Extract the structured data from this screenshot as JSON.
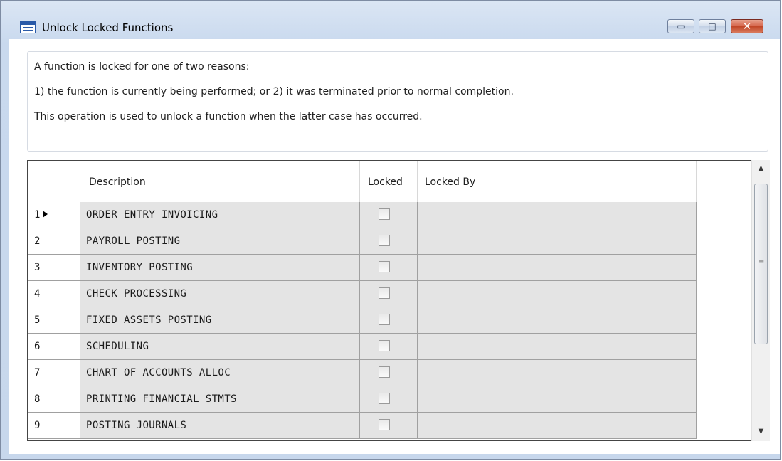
{
  "window": {
    "title": "Unlock Locked Functions",
    "controls": {
      "minimize": "▭",
      "maximize": "□",
      "close": "✕"
    }
  },
  "info": {
    "line1": "A function is locked for one of two reasons:",
    "line2": "1) the function is currently being performed;  or 2) it was terminated prior to normal completion.",
    "line3": "This operation is used to unlock a function when the latter case has occurred."
  },
  "grid": {
    "columns": {
      "description": "Description",
      "locked": "Locked",
      "locked_by": "Locked By"
    },
    "current_row_indicator": "▶",
    "rows": [
      {
        "num": "1",
        "description": "ORDER ENTRY INVOICING",
        "locked": false,
        "locked_by": ""
      },
      {
        "num": "2",
        "description": "PAYROLL POSTING",
        "locked": false,
        "locked_by": ""
      },
      {
        "num": "3",
        "description": "INVENTORY POSTING",
        "locked": false,
        "locked_by": ""
      },
      {
        "num": "4",
        "description": "CHECK PROCESSING",
        "locked": false,
        "locked_by": ""
      },
      {
        "num": "5",
        "description": "FIXED ASSETS POSTING",
        "locked": false,
        "locked_by": ""
      },
      {
        "num": "6",
        "description": "SCHEDULING",
        "locked": false,
        "locked_by": ""
      },
      {
        "num": "7",
        "description": "CHART OF ACCOUNTS ALLOC",
        "locked": false,
        "locked_by": ""
      },
      {
        "num": "8",
        "description": "PRINTING FINANCIAL STMTS",
        "locked": false,
        "locked_by": ""
      },
      {
        "num": "9",
        "description": "POSTING JOURNALS",
        "locked": false,
        "locked_by": ""
      }
    ]
  },
  "scrollbar": {
    "up": "▲",
    "down": "▼",
    "grip": "≡"
  }
}
